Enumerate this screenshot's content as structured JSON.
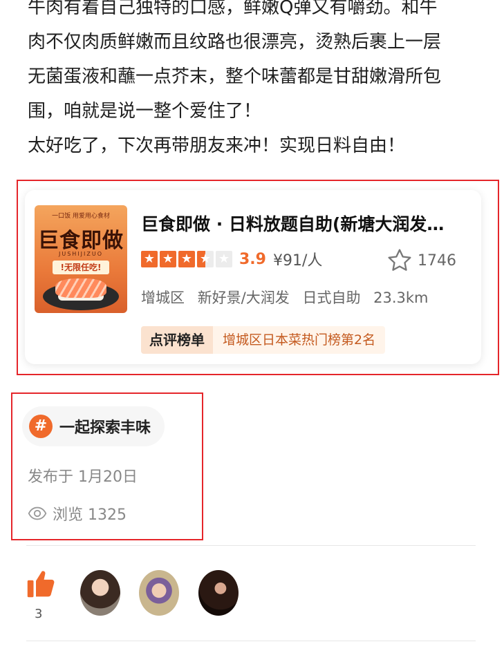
{
  "article": {
    "lines": [
      "牛肉有着自己独特的口感，鲜嫩Q弹又有嚼劲。和牛",
      "肉不仅肉质鲜嫩而且纹路也很漂亮，烫熟后裹上一层",
      "无菌蛋液和蘸一点芥末，整个味蕾都是甘甜嫩滑所包",
      "围，咱就是说一整个爱住了！",
      "太好吃了，下次再带朋友来冲！实现日料自由！"
    ]
  },
  "poi_card": {
    "thumbnail": {
      "top_text": "一口饭 用爱用心食材",
      "title": "巨食即做",
      "subtitle": "JUSHIJIZUO",
      "tag": "!无限任吃!"
    },
    "name": "巨食即做 · 日料放题自助(新塘大润发…",
    "rating": {
      "stars": 3.5,
      "score": "3.9",
      "price": "¥91/人"
    },
    "favorites": "1746",
    "district": "增城区",
    "area": "新好景/大润发",
    "category": "日式自助",
    "distance": "23.3km",
    "rank_label": "点评榜单",
    "rank_text": "增城区日本菜热门榜第2名",
    "colors": {
      "accent": "#f06a2b"
    }
  },
  "topic": {
    "icon": "hash-icon",
    "label": "一起探索丰味"
  },
  "meta": {
    "publish": "发布于 1月20日",
    "views": "浏览 1325"
  },
  "likes": {
    "count": "3",
    "icon": "thumbs-up-icon"
  },
  "annotation_color": "#e5252a"
}
